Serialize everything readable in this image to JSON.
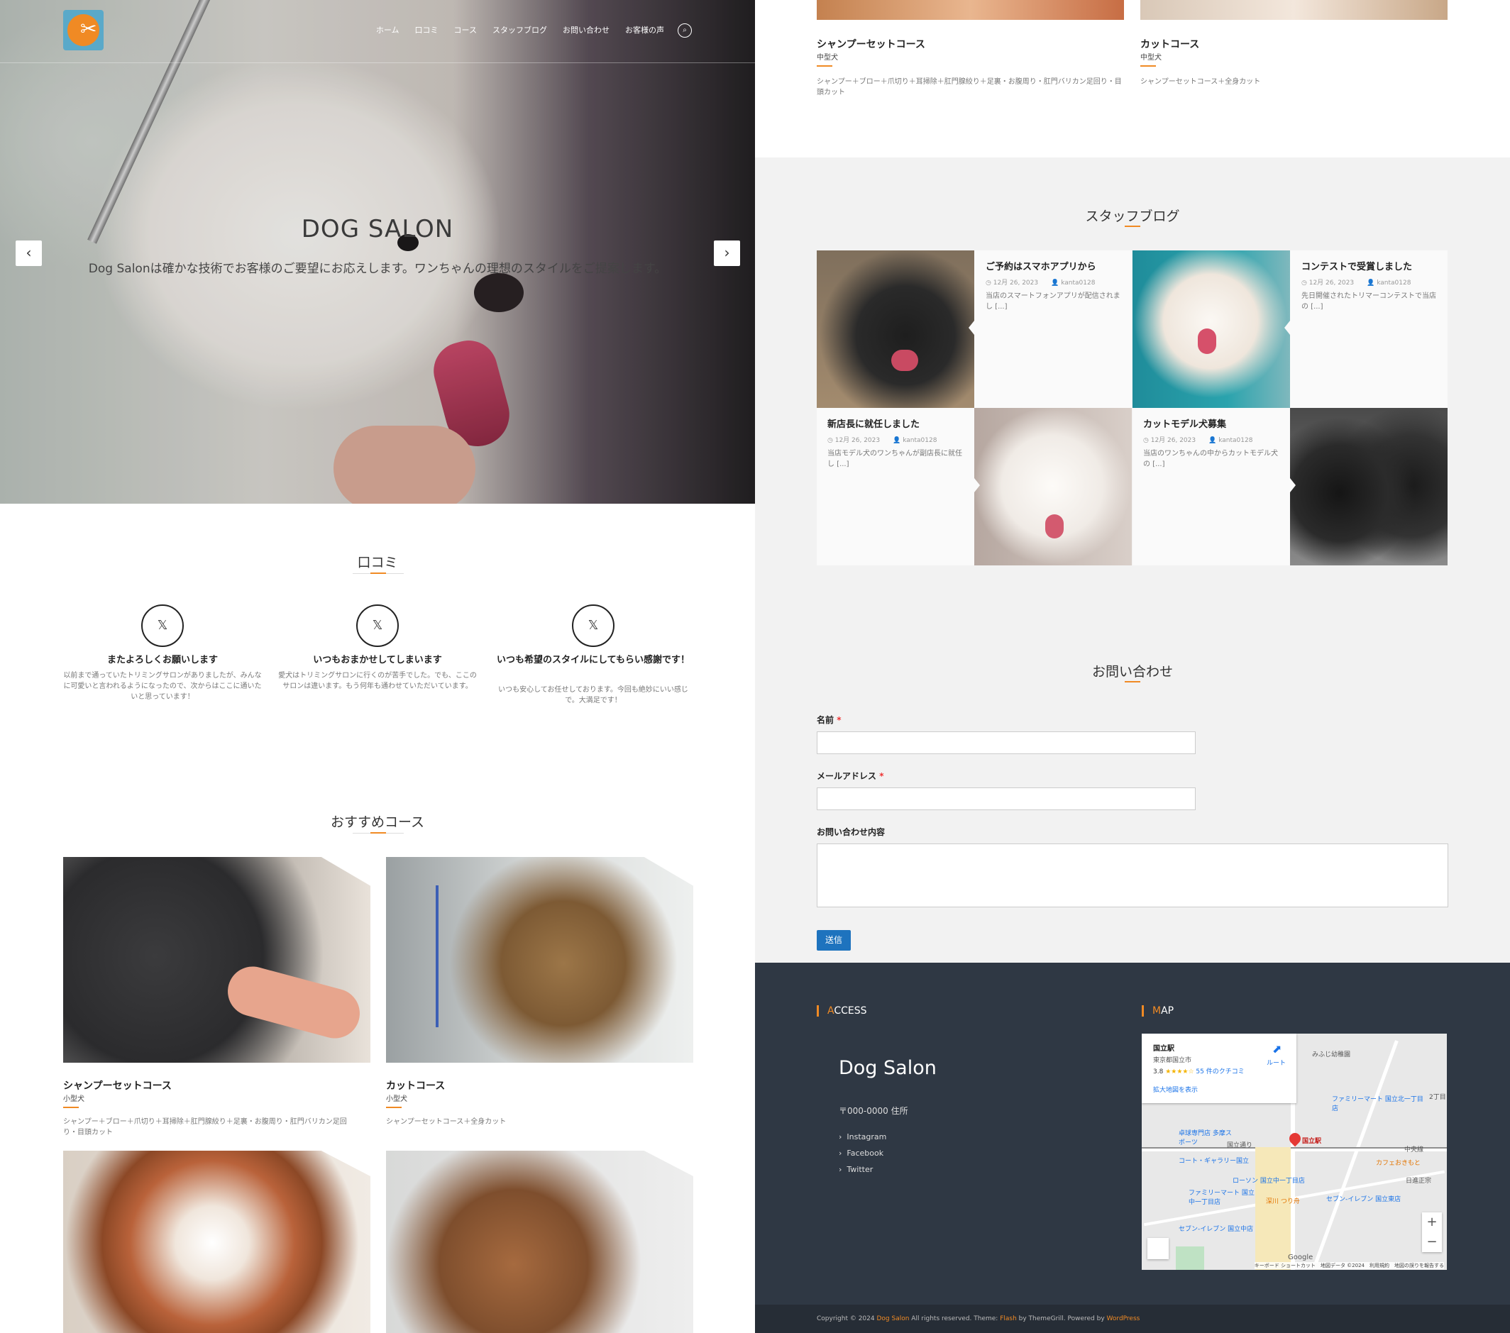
{
  "nav": {
    "items": [
      "ホーム",
      "口コミ",
      "コース",
      "スタッフブログ",
      "お問い合わせ",
      "お客様の声"
    ],
    "search_icon": "search-icon"
  },
  "hero": {
    "title": "DOG SALON",
    "subtitle": "Dog Salonは確かな技術でお客様のご要望にお応えします。ワンちゃんの理想のスタイルをご提案します。",
    "prev": "‹",
    "next": "›"
  },
  "reviews": {
    "title": "口コミ",
    "items": [
      {
        "icon": "twitter-icon",
        "name": "またよろしくお願いします",
        "text": "以前まで通っていたトリミングサロンがありましたが、みんなに可愛いと言われるようになったので、次からはここに通いたいと思っています！"
      },
      {
        "icon": "twitter-icon",
        "name": "いつもおまかせしてしまいます",
        "text": "愛犬はトリミングサロンに行くのが苦手でした。でも、ここのサロンは違います。もう何年も通わせていただいています。"
      },
      {
        "icon": "twitter-icon",
        "name": "いつも希望のスタイルにしてもらい感謝です！",
        "text": "いつも安心してお任せしております。今回も絶妙にいい感じで。大満足です！"
      }
    ]
  },
  "courses": {
    "title": "おすすめコース",
    "items": [
      {
        "title": "シャンプーセットコース",
        "size": "小型犬",
        "desc": "シャンプー＋ブロー＋爪切り＋耳掃除＋肛門腺絞り＋足裏・お腹周り・肛門バリカン足回り・目頭カット"
      },
      {
        "title": "カットコース",
        "size": "小型犬",
        "desc": "シャンプーセットコース＋全身カット"
      },
      {
        "title": "シャンプーセットコース",
        "size": "中型犬",
        "desc": "シャンプー＋ブロー＋爪切り＋耳掃除＋肛門腺絞り＋足裏・お腹周り・肛門バリカン足回り・目頭カット"
      },
      {
        "title": "カットコース",
        "size": "中型犬",
        "desc": "シャンプーセットコース＋全身カット"
      }
    ]
  },
  "blog": {
    "title": "スタッフブログ",
    "posts": [
      {
        "title": "ご予約はスマホアプリから",
        "date": "12月 26, 2023",
        "author": "kanta0128",
        "excerpt": "当店のスマートフォンアプリが配信されまし [...]"
      },
      {
        "title": "コンテストで受賞しました",
        "date": "12月 26, 2023",
        "author": "kanta0128",
        "excerpt": "先日開催されたトリマーコンテストで当店の [...]"
      },
      {
        "title": "新店長に就任しました",
        "date": "12月 26, 2023",
        "author": "kanta0128",
        "excerpt": "当店モデル犬のワンちゃんが副店長に就任し [...]"
      },
      {
        "title": "カットモデル犬募集",
        "date": "12月 26, 2023",
        "author": "kanta0128",
        "excerpt": "当店のワンちゃんの中からカットモデル犬の [...]"
      }
    ]
  },
  "contact": {
    "title": "お問い合わせ",
    "name_label": "名前",
    "email_label": "メールアドレス",
    "message_label": "お問い合わせ内容",
    "required_mark": "*",
    "submit": "送信"
  },
  "footer": {
    "access_head_first": "A",
    "access_head_rest": "CCESS",
    "map_head_first": "M",
    "map_head_rest": "AP",
    "brand": "Dog Salon",
    "address": "〒000-0000 住所",
    "links": [
      "Instagram",
      "Facebook",
      "Twitter"
    ],
    "copyright_pre": "Copyright © 2024 ",
    "copyright_site": "Dog Salon",
    "copyright_mid": " All rights reserved. Theme: ",
    "copyright_theme": "Flash",
    "copyright_by": " by ThemeGrill. Powered by ",
    "copyright_wp": "WordPress"
  },
  "map": {
    "place": "国立駅",
    "city": "東京都国立市",
    "rating": "3.8",
    "stars": "★★★★☆",
    "reviews": "55 件のクチコミ",
    "route": "ルート",
    "enlarge": "拡大地図を表示",
    "pin_label": "国立駅",
    "labels": [
      "みふじ幼稚園",
      "ファミリーマート 国立北一丁目店",
      "卓球専門店 多摩スポーツ",
      "コート・ギャラリー国立",
      "カフェおきもと",
      "ローソン 国立中一丁目店",
      "ファミリーマート 国立中一丁目店",
      "深川 つり舟",
      "セブン-イレブン 国立東店",
      "セブン-イレブン 国立中店",
      "日進正宗",
      "中央線",
      "国立通り",
      "2丁目"
    ],
    "zoom_in": "+",
    "zoom_out": "−",
    "attribution": "キーボード ショートカット　地図データ ©2024　利用規約　地図の誤りを報告する",
    "google": "Google"
  }
}
